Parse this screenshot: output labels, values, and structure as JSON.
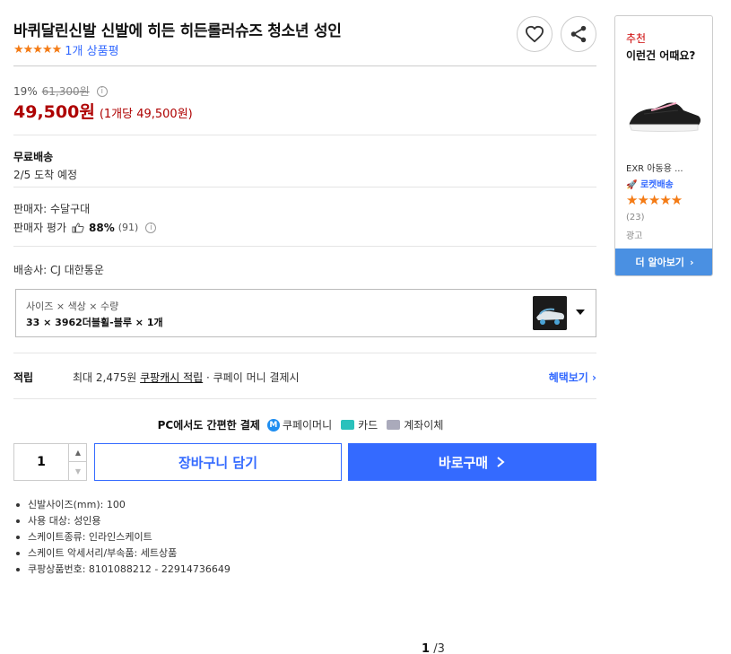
{
  "product": {
    "title": "바퀴달린신발 신발에 히든 히든롤러슈즈 청소년 성인",
    "stars": "★★★★★",
    "review_count": "1개 상품평"
  },
  "price": {
    "discount_rate": "19%",
    "original": "61,300원",
    "sale": "49,500원",
    "unit_price": "(1개당 49,500원)"
  },
  "shipping": {
    "title": "무료배송",
    "arrival": "2/5 도착 예정"
  },
  "seller": {
    "name": "판매자: 수달구대",
    "rating_label": "판매자 평가",
    "rating_pct": "88%",
    "rating_count": "(91)"
  },
  "carrier": "배송사: CJ 대한통운",
  "option": {
    "label": "사이즈 × 색상 × 수량",
    "value": "33 × 3962더블휠-블루 × 1개"
  },
  "points": {
    "label": "적립",
    "text_prefix": "최대 2,475원",
    "link": "쿠팡캐시 적립",
    "text_suffix": "· 쿠페이 머니 결제시",
    "benefit": "혜택보기"
  },
  "payment": {
    "lead": "PC에서도 간편한 결제",
    "coupay": "쿠페이머니",
    "card": "카드",
    "bank": "계좌이체"
  },
  "purchase": {
    "quantity": "1",
    "cart_label": "장바구니 담기",
    "buy_label": "바로구매"
  },
  "specs": [
    "신발사이즈(mm): 100",
    "사용 대상: 성인용",
    "스케이트종류: 인라인스케이트",
    "스케이트 악세서리/부속품: 세트상품",
    "쿠팡상품번호: 8101088212 - 22914736649"
  ],
  "pager": {
    "current": "1",
    "total": "/3"
  },
  "ad": {
    "tag": "추천",
    "title": "이런건 어때요?",
    "name": "EXR 아동용 ...",
    "rocket": "로켓배송",
    "stars": "★★★★★",
    "count": "(23)",
    "label": "광고",
    "more": "더 알아보기"
  },
  "colors": {
    "accent": "#346aff",
    "price": "#ae0000",
    "star": "#f47b15"
  }
}
